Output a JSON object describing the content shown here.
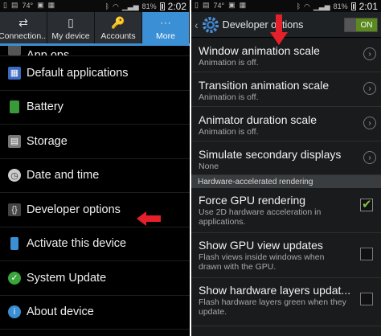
{
  "left": {
    "status": {
      "network": "74°",
      "battery": "81%",
      "time": "2:02"
    },
    "tabs": [
      {
        "label": "Connection...",
        "icon": "connections-icon"
      },
      {
        "label": "My device",
        "icon": "device-icon"
      },
      {
        "label": "Accounts",
        "icon": "accounts-icon"
      },
      {
        "label": "More",
        "icon": "more-icon",
        "active": true
      }
    ],
    "items": [
      {
        "label": "App ops",
        "icon": "app-ops-icon",
        "color": "#555"
      },
      {
        "label": "Default applications",
        "icon": "default-apps-icon",
        "color": "#3c6ac2"
      },
      {
        "label": "Battery",
        "icon": "battery-icon",
        "color": "#3a9a3a"
      },
      {
        "label": "Storage",
        "icon": "storage-icon",
        "color": "#888"
      },
      {
        "label": "Date and time",
        "icon": "clock-icon",
        "color": "#bbb"
      },
      {
        "label": "Developer options",
        "icon": "braces-icon",
        "color": "#777"
      },
      {
        "label": "Activate this device",
        "icon": "phone-icon",
        "color": "#3b8fd4"
      },
      {
        "label": "System Update",
        "icon": "update-icon",
        "color": "#3aa53a"
      },
      {
        "label": "About device",
        "icon": "info-icon",
        "color": "#3b8fd4"
      }
    ]
  },
  "right": {
    "status": {
      "network": "74°",
      "battery": "81%",
      "time": "2:01"
    },
    "title": "Developer options",
    "switch_label": "ON",
    "items": [
      {
        "title": "Window animation scale",
        "sub": "Animation is off.",
        "control": "chevron"
      },
      {
        "title": "Transition animation scale",
        "sub": "Animation is off.",
        "control": "chevron"
      },
      {
        "title": "Animator duration scale",
        "sub": "Animation is off.",
        "control": "chevron"
      },
      {
        "title": "Simulate secondary displays",
        "sub": "None",
        "control": "chevron"
      }
    ],
    "section": "Hardware-accelerated rendering",
    "checks": [
      {
        "title": "Force GPU rendering",
        "sub": "Use 2D hardware acceleration in applications.",
        "checked": true
      },
      {
        "title": "Show GPU view updates",
        "sub": "Flash views inside windows when drawn with the GPU.",
        "checked": false
      },
      {
        "title": "Show hardware layers updat...",
        "sub": "Flash hardware layers green when they update.",
        "checked": false
      }
    ]
  },
  "colors": {
    "accent": "#3b8fd4",
    "arrow": "#e4202a",
    "check": "#7dc242"
  }
}
